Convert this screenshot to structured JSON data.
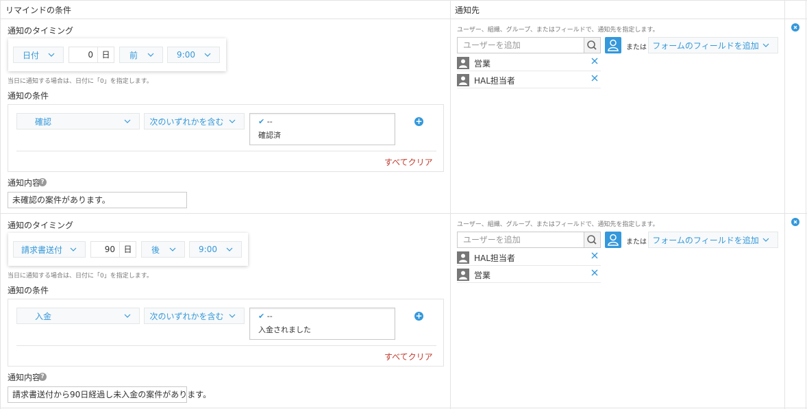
{
  "header": {
    "conditions_title": "リマインドの条件",
    "recipients_title": "通知先"
  },
  "reminders": [
    {
      "timing_label": "通知のタイミング",
      "date_field": "日付",
      "days": "0",
      "days_unit": "日",
      "relation": "前",
      "time": "9:00",
      "timing_hint": "当日に通知する場合は、日付に「0」を指定します。",
      "condition_label": "通知の条件",
      "cond_field": "確認",
      "cond_operator": "次のいずれかを含む",
      "cond_options": [
        "--",
        "確認済"
      ],
      "clear_all": "すべてクリア",
      "message_label": "通知内容",
      "message": "未確認の案件があります。",
      "recipients_hint": "ユーザー、組織、グループ、またはフィールドで、通知先を指定します。",
      "user_search_placeholder": "ユーザーを追加",
      "or_text": "または",
      "field_select": "フォームのフィールドを追加",
      "recipients": [
        "営業",
        "HAL担当者"
      ]
    },
    {
      "timing_label": "通知のタイミング",
      "date_field": "請求書送付",
      "days": "90",
      "days_unit": "日",
      "relation": "後",
      "time": "9:00",
      "timing_hint": "当日に通知する場合は、日付に「0」を指定します。",
      "condition_label": "通知の条件",
      "cond_field": "入金",
      "cond_operator": "次のいずれかを含む",
      "cond_options": [
        "--",
        "入金されました"
      ],
      "clear_all": "すべてクリア",
      "message_label": "通知内容",
      "message": "請求書送付から90日経過し未入金の案件があります。",
      "recipients_hint": "ユーザー、組織、グループ、またはフィールドで、通知先を指定します。",
      "user_search_placeholder": "ユーザーを追加",
      "or_text": "または",
      "field_select": "フォームのフィールドを追加",
      "recipients": [
        "HAL担当者",
        "営業"
      ]
    }
  ],
  "icons": {
    "chevron": "chevron-down-icon",
    "search": "search-icon",
    "user_picker": "user-icon",
    "remove": "close-icon",
    "add": "plus-icon",
    "delete_row": "delete-circle-icon",
    "help": "question-icon"
  },
  "colors": {
    "accent": "#3498db",
    "clear_link": "#c0392b",
    "border": "#e3e3e3"
  }
}
